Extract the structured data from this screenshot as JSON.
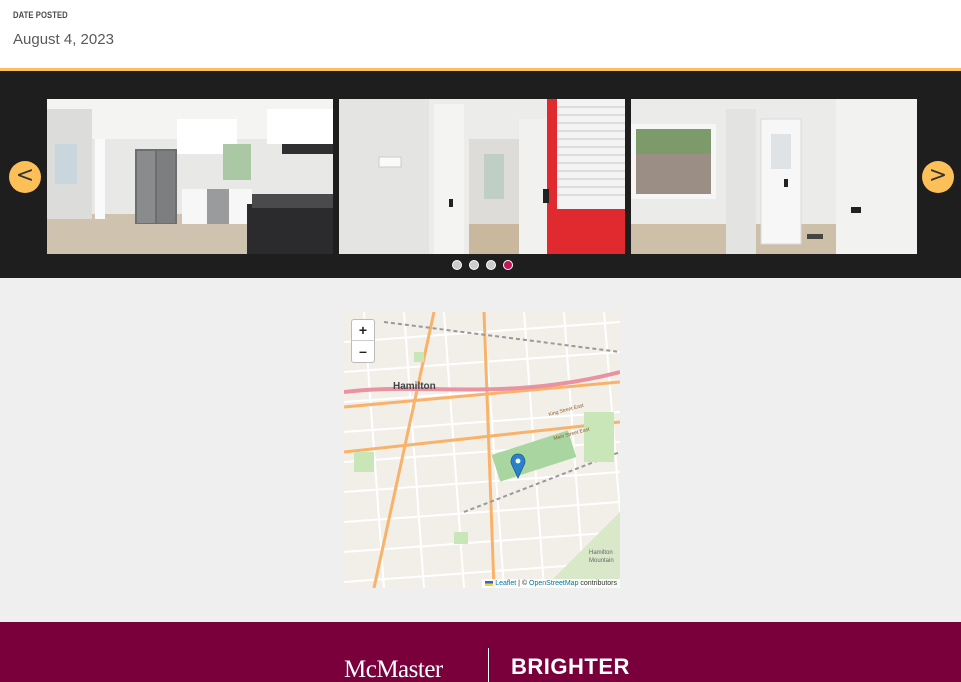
{
  "header": {
    "date_label": "DATE POSTED",
    "date_value": "August 4, 2023"
  },
  "carousel": {
    "prev_label": "<",
    "next_label": ">",
    "slide_count": 4,
    "active_slide": 4
  },
  "map": {
    "zoom_in": "+",
    "zoom_out": "–",
    "city_label": "Hamilton",
    "street_1": "King Street East",
    "street_2": "Main Street East",
    "area_label_1": "Hamilton",
    "area_label_2": "Mountain",
    "attribution_leaflet": "Leaflet",
    "attribution_sep": " | © ",
    "attribution_osm": "OpenStreetMap",
    "attribution_tail": " contributors"
  },
  "footer": {
    "logo_text": "McMaster",
    "tagline": "BRIGHTER"
  },
  "colors": {
    "gold": "#fdbf57",
    "maroon": "#7a003c",
    "active_dot": "#c2185b",
    "marker": "#2a81cb"
  }
}
